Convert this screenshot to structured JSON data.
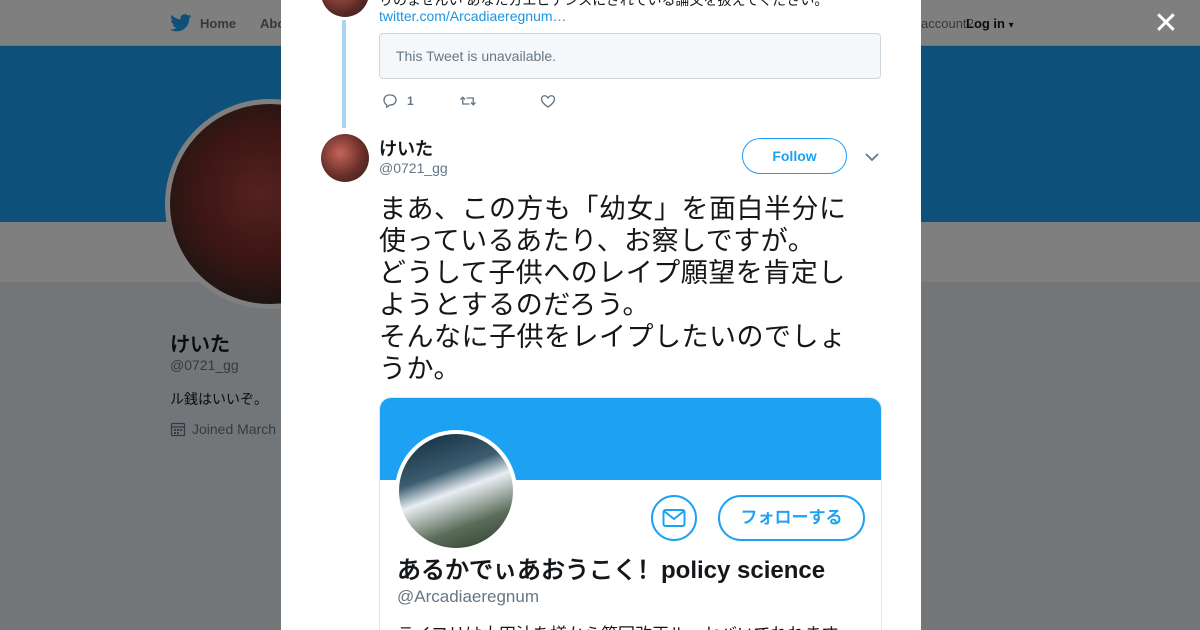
{
  "topbar": {
    "home_label": "Home",
    "about_label": "Abo",
    "account_prompt": "account?",
    "login_label": "Log in"
  },
  "profile": {
    "name": "けいた",
    "handle": "@0721_gg",
    "bio": "ル銭はいいぞ。",
    "joined": "Joined March"
  },
  "modal": {
    "previous_tweet": {
      "text_fragment": "りのませんい あなたガエピテンスにされている論文を扱えてください。",
      "link": "twitter.com/Arcadiaeregnum…",
      "unavailable_text": "This Tweet is unavailable.",
      "reply_count": "1",
      "retweet_count": "",
      "like_count": ""
    },
    "tweet": {
      "name": "けいた",
      "handle": "@0721_gg",
      "follow_label": "Follow",
      "text": "まあ、この方も「幼女」を面白半分に使っているあたり、お察しですが。\nどうして子供へのレイプ願望を肯定しようとするのだろう。\nそんなに子供をレイプしたいのでしょうか。"
    },
    "card": {
      "follow_label": "フォローする",
      "name": "あるかでぃあおうこく！policy science",
      "handle": "@Arcadiaeregnum",
      "bio_fragment": "ライフリは大田汁を様から第回改正ルーセバいでれれます"
    }
  },
  "colors": {
    "brand_blue": "#1da1f2",
    "link_blue": "#1b95e0",
    "thread_line": "#a8d5f4"
  },
  "icons": {
    "twitter": "twitter-bird-icon",
    "close": "close-icon",
    "reply": "reply-icon",
    "retweet": "retweet-icon",
    "like": "heart-icon",
    "caret": "chevron-down-icon",
    "mail": "mail-icon",
    "calendar": "calendar-icon"
  }
}
